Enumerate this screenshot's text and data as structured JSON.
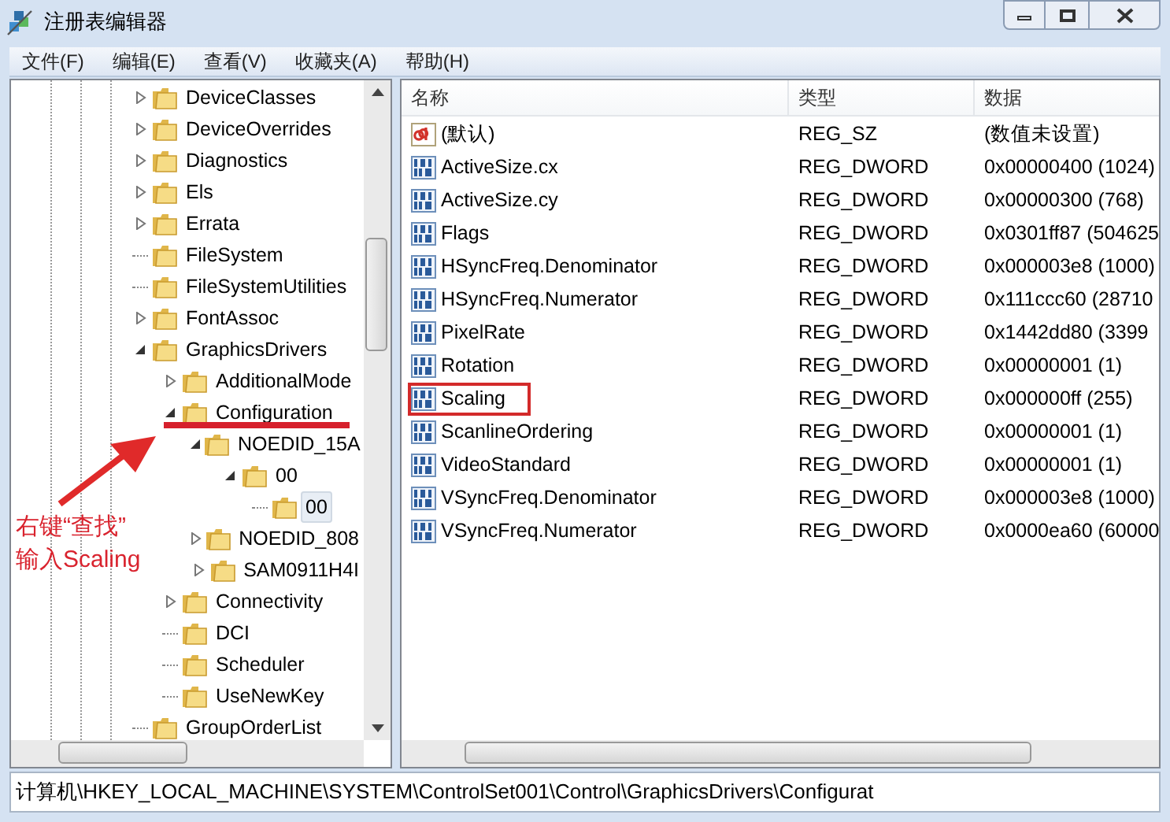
{
  "window": {
    "title": "注册表编辑器"
  },
  "menu": [
    "文件(F)",
    "编辑(E)",
    "查看(V)",
    "收藏夹(A)",
    "帮助(H)"
  ],
  "tree": [
    {
      "label": "DeviceClasses",
      "kind": "expandable",
      "expanded": false,
      "selected": false
    },
    {
      "label": "DeviceOverrides",
      "kind": "expandable",
      "expanded": false,
      "selected": false
    },
    {
      "label": "Diagnostics",
      "kind": "expandable",
      "expanded": false,
      "selected": false
    },
    {
      "label": "Els",
      "kind": "expandable",
      "expanded": false,
      "selected": false
    },
    {
      "label": "Errata",
      "kind": "expandable",
      "expanded": false,
      "selected": false
    },
    {
      "label": "FileSystem",
      "kind": "leaf",
      "selected": false
    },
    {
      "label": "FileSystemUtilities",
      "kind": "leaf",
      "selected": false
    },
    {
      "label": "FontAssoc",
      "kind": "expandable",
      "expanded": false,
      "selected": false
    },
    {
      "label": "GraphicsDrivers",
      "kind": "expandable",
      "expanded": true,
      "selected": false,
      "children": [
        {
          "label": "AdditionalMode",
          "kind": "expandable",
          "expanded": false,
          "selected": false
        },
        {
          "label": "Configuration",
          "kind": "expandable",
          "expanded": true,
          "selected": false,
          "children": [
            {
              "label": "NOEDID_15A",
              "kind": "expandable",
              "expanded": true,
              "selected": false,
              "children": [
                {
                  "label": "00",
                  "kind": "expandable",
                  "expanded": true,
                  "selected": false,
                  "children": [
                    {
                      "label": "00",
                      "kind": "leaf",
                      "selected": true
                    }
                  ]
                }
              ]
            },
            {
              "label": "NOEDID_808",
              "kind": "expandable",
              "expanded": false,
              "selected": false
            },
            {
              "label": "SAM0911H4I",
              "kind": "expandable",
              "expanded": false,
              "selected": false
            }
          ]
        },
        {
          "label": "Connectivity",
          "kind": "expandable",
          "expanded": false,
          "selected": false
        },
        {
          "label": "DCI",
          "kind": "leaf",
          "selected": false
        },
        {
          "label": "Scheduler",
          "kind": "leaf",
          "selected": false
        },
        {
          "label": "UseNewKey",
          "kind": "leaf",
          "selected": false
        }
      ]
    },
    {
      "label": "GroupOrderList",
      "kind": "leaf",
      "selected": false
    }
  ],
  "table": {
    "columns": [
      "名称",
      "类型",
      "数据"
    ],
    "rows": [
      {
        "kind": "string",
        "name": "(默认)",
        "type": "REG_SZ",
        "data": "(数值未设置)",
        "boxed": false
      },
      {
        "kind": "dword",
        "name": "ActiveSize.cx",
        "type": "REG_DWORD",
        "data": "0x00000400 (1024)",
        "boxed": false
      },
      {
        "kind": "dword",
        "name": "ActiveSize.cy",
        "type": "REG_DWORD",
        "data": "0x00000300 (768)",
        "boxed": false
      },
      {
        "kind": "dword",
        "name": "Flags",
        "type": "REG_DWORD",
        "data": "0x0301ff87 (504625",
        "boxed": false
      },
      {
        "kind": "dword",
        "name": "HSyncFreq.Denominator",
        "type": "REG_DWORD",
        "data": "0x000003e8 (1000)",
        "boxed": false
      },
      {
        "kind": "dword",
        "name": "HSyncFreq.Numerator",
        "type": "REG_DWORD",
        "data": "0x111ccc60 (28710",
        "boxed": false
      },
      {
        "kind": "dword",
        "name": "PixelRate",
        "type": "REG_DWORD",
        "data": "0x1442dd80 (3399",
        "boxed": false
      },
      {
        "kind": "dword",
        "name": "Rotation",
        "type": "REG_DWORD",
        "data": "0x00000001 (1)",
        "boxed": false
      },
      {
        "kind": "dword",
        "name": "Scaling",
        "type": "REG_DWORD",
        "data": "0x000000ff (255)",
        "boxed": true
      },
      {
        "kind": "dword",
        "name": "ScanlineOrdering",
        "type": "REG_DWORD",
        "data": "0x00000001 (1)",
        "boxed": false
      },
      {
        "kind": "dword",
        "name": "VideoStandard",
        "type": "REG_DWORD",
        "data": "0x00000001 (1)",
        "boxed": false
      },
      {
        "kind": "dword",
        "name": "VSyncFreq.Denominator",
        "type": "REG_DWORD",
        "data": "0x000003e8 (1000)",
        "boxed": false
      },
      {
        "kind": "dword",
        "name": "VSyncFreq.Numerator",
        "type": "REG_DWORD",
        "data": "0x0000ea60 (60000",
        "boxed": false
      }
    ]
  },
  "annotation": {
    "lines": [
      "右键“查找”",
      "输入Scaling"
    ]
  },
  "status_bar": "计算机\\HKEY_LOCAL_MACHINE\\SYSTEM\\ControlSet001\\Control\\GraphicsDrivers\\Configurat"
}
